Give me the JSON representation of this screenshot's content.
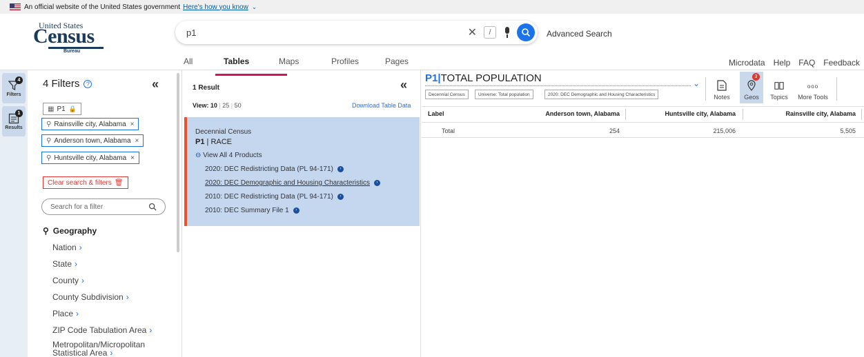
{
  "gov_banner": {
    "text": "An official website of the United States government",
    "link": "Here's how you know"
  },
  "logo": {
    "line1": "United States",
    "line2": "Census",
    "line3": "Bureau"
  },
  "search": {
    "value": "p1",
    "slash": "/"
  },
  "advanced_search": "Advanced Search",
  "tabs": [
    {
      "label": "All",
      "active": false
    },
    {
      "label": "Tables",
      "active": true
    },
    {
      "label": "Maps",
      "active": false
    },
    {
      "label": "Profiles",
      "active": false
    },
    {
      "label": "Pages",
      "active": false
    }
  ],
  "top_links": [
    "Microdata",
    "Help",
    "FAQ",
    "Feedback"
  ],
  "rail": {
    "filters": {
      "label": "Filters",
      "badge": "4"
    },
    "results": {
      "label": "Results",
      "badge": "1"
    }
  },
  "filters_panel": {
    "title": "4 Filters",
    "table_chip": "P1",
    "chips": [
      "Rainsville city, Alabama",
      "Anderson town, Alabama",
      "Huntsville city, Alabama"
    ],
    "clear_label": "Clear search & filters",
    "search_placeholder": "Search for a filter",
    "geography_label": "Geography",
    "geo_items": [
      "Nation",
      "State",
      "County",
      "County Subdivision",
      "Place",
      "ZIP Code Tabulation Area",
      "Metropolitan/Micropolitan",
      "Statistical Area"
    ]
  },
  "results_panel": {
    "title": "1 Result",
    "view_label": "View: 10",
    "view_25": "25",
    "view_50": "50",
    "download": "Download Table Data",
    "card": {
      "program": "Decennial Census",
      "table_id": "P1",
      "table_sep": "|",
      "table_name": "RACE",
      "view_all": "View All 4 Products",
      "products": [
        "2020: DEC Redistricting Data (PL 94-171)",
        "2020: DEC Demographic and Housing Characteristics",
        "2010: DEC Redistricting Data (PL 94-171)",
        "2010: DEC Summary File 1"
      ]
    }
  },
  "table_panel": {
    "id": "P1",
    "sep": "|",
    "title": "TOTAL POPULATION",
    "pills": [
      "Decennial Census",
      "Universe: Total population",
      "2020: DEC Demographic and Housing Characteristics"
    ],
    "tools": [
      {
        "label": "Notes"
      },
      {
        "label": "Geos",
        "badge": "3"
      },
      {
        "label": "Topics"
      },
      {
        "label": "More Tools",
        "glyph": "ooo"
      }
    ],
    "headers": [
      "Label",
      "Anderson town, Alabama",
      "Huntsville city, Alabama",
      "Rainsville city, Alabama"
    ],
    "rows": [
      {
        "label": "Total",
        "values": [
          "254",
          "215,006",
          "5,505"
        ]
      }
    ]
  },
  "colors": {
    "accent": "#1a73e8",
    "tab_underline": "#d4145a",
    "card_bg": "#c5d7ef",
    "card_border": "#e8542a",
    "clear_red": "#e3342f"
  }
}
